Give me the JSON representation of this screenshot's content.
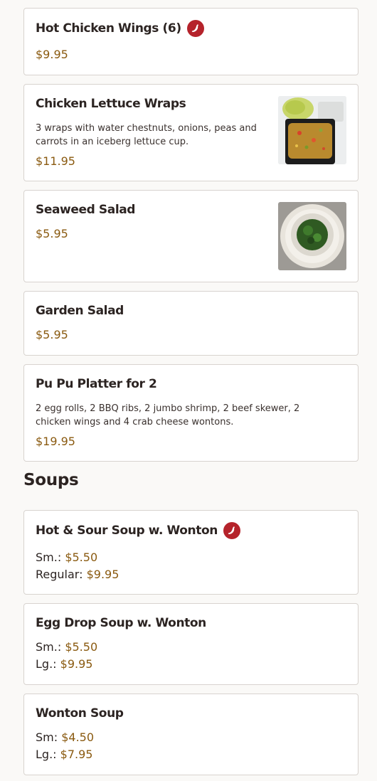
{
  "items": [
    {
      "name": "Hot Chicken Wings (6)",
      "price": "$9.95",
      "spicy": true
    },
    {
      "name": "Chicken Lettuce Wraps",
      "description": "3 wraps with water chestnuts, onions, peas and carrots in an iceberg lettuce cup.",
      "price": "$11.95"
    },
    {
      "name": "Seaweed Salad",
      "price": "$5.95"
    },
    {
      "name": "Garden Salad",
      "price": "$5.95"
    },
    {
      "name": "Pu Pu Platter for 2",
      "description": "2 egg rolls, 2 BBQ ribs, 2 jumbo shrimp, 2 beef skewer, 2 chicken wings and 4 crab cheese wontons.",
      "price": "$19.95"
    }
  ],
  "soups": {
    "title": "Soups",
    "items": [
      {
        "name": "Hot & Sour Soup w. Wonton",
        "spicy": true,
        "sizes": [
          {
            "label": "Sm.:",
            "price": "$5.50"
          },
          {
            "label": "Regular:",
            "price": "$9.95"
          }
        ]
      },
      {
        "name": "Egg Drop Soup w. Wonton",
        "sizes": [
          {
            "label": "Sm.:",
            "price": "$5.50"
          },
          {
            "label": "Lg.:",
            "price": "$9.95"
          }
        ]
      },
      {
        "name": "Wonton Soup",
        "sizes": [
          {
            "label": "Sm:",
            "price": "$4.50"
          },
          {
            "label": "Lg.:",
            "price": "$7.95"
          }
        ]
      }
    ]
  },
  "icons": {
    "spicy": "chili-pepper-icon"
  },
  "colors": {
    "price": "#8a5a10",
    "spicy_badge": "#b5232b",
    "border": "#d8d3cf"
  }
}
